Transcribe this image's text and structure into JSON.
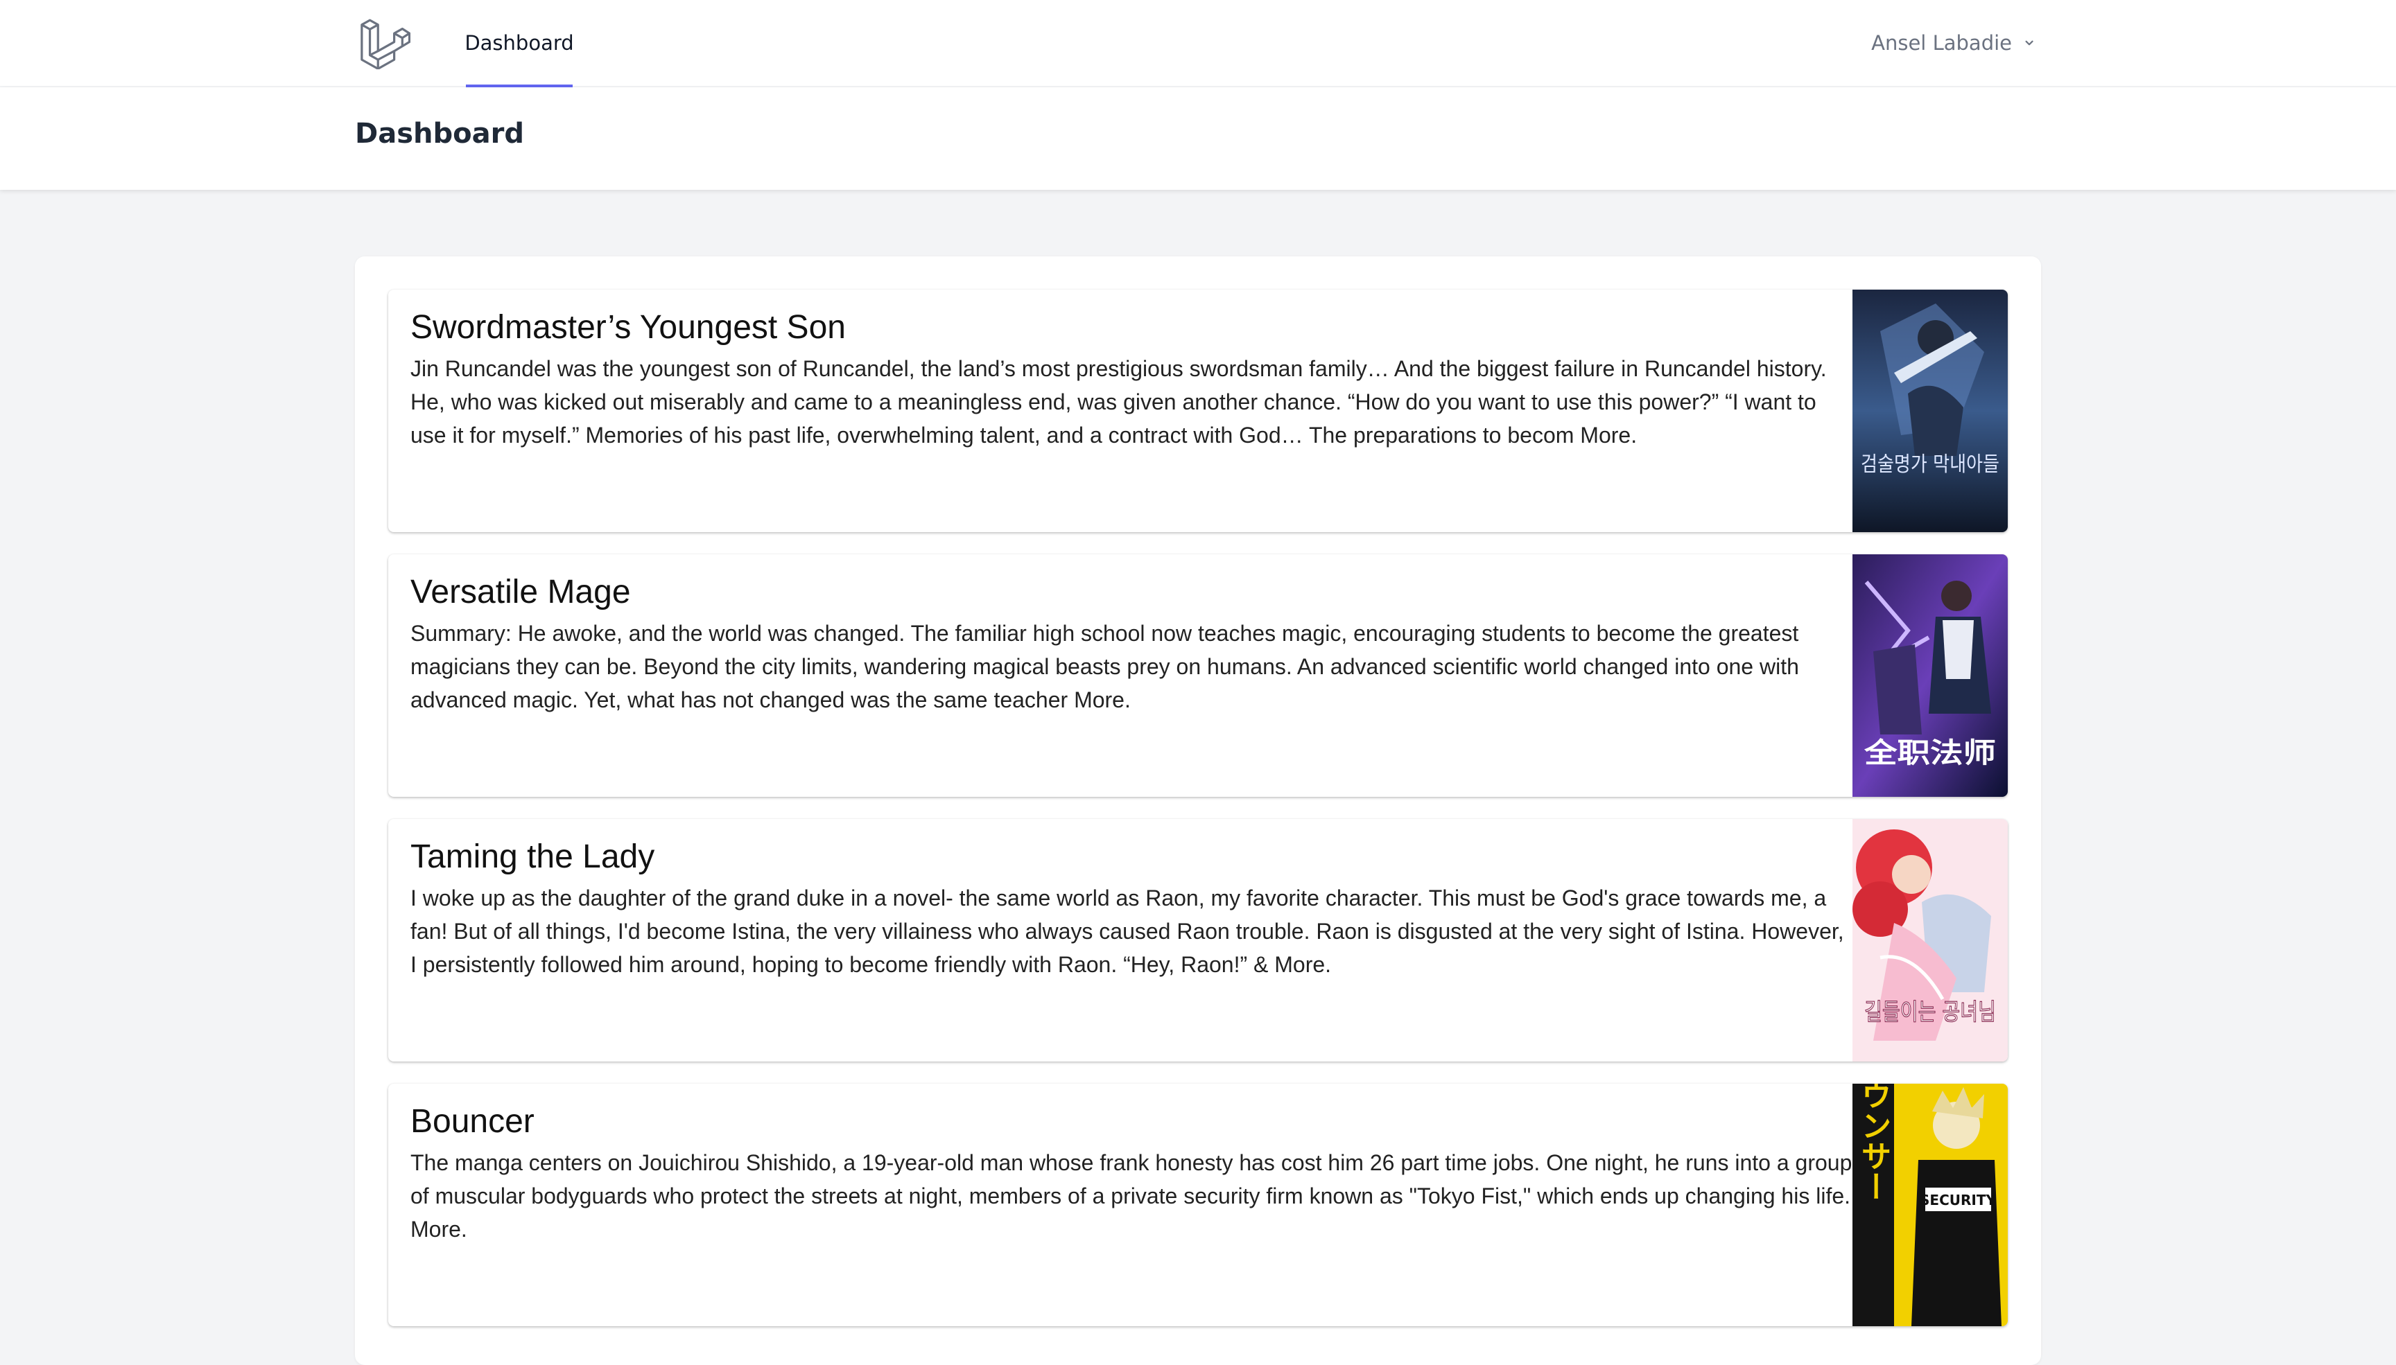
{
  "nav": {
    "links": [
      {
        "label": "Dashboard",
        "active": true
      }
    ],
    "user_name": "Ansel Labadie",
    "accent_color": "#6366f1"
  },
  "header": {
    "title": "Dashboard"
  },
  "cards": [
    {
      "title": "Swordmaster’s Youngest Son",
      "summary": "Jin Runcandel was the youngest son of Runcandel, the land’s most prestigious swordsman family… And the biggest failure in Runcandel history. He, who was kicked out miserably and came to a meaningless end, was given another chance. “How do you want to use this power?” “I want to use it for myself.” Memories of his past life, overwhelming talent, and a contract with God… The preparations to becom More.",
      "cover_text": "검술명가 막내아들"
    },
    {
      "title": "Versatile Mage",
      "summary": "Summary: He awoke, and the world was changed. The familiar high school now teaches magic, encouraging students to become the greatest magicians they can be. Beyond the city limits, wandering magical beasts prey on humans. An advanced scientific world changed into one with advanced magic. Yet, what has not changed was the same teacher More.",
      "cover_text": "全职法师"
    },
    {
      "title": "Taming the Lady",
      "summary": "I woke up as the daughter of the grand duke in a novel- the same world as Raon, my favorite character. This must be God's grace towards me, a fan! But of all things, I'd become Istina, the very villainess who always caused Raon trouble. Raon is disgusted at the very sight of Istina. However, I persistently followed him around, hoping to become friendly with Raon. “Hey, Raon!” & More.",
      "cover_text": "길들이는 공녀님"
    },
    {
      "title": "Bouncer",
      "summary": "The manga centers on Jouichirou Shishido, a 19-year-old man whose frank honesty has cost him 26 part time jobs. One night, he runs into a group of muscular bodyguards who protect the streets at night, members of a private security firm known as \"Tokyo Fist,\" which ends up changing his life. More.",
      "cover_text": "バウンサー"
    }
  ]
}
